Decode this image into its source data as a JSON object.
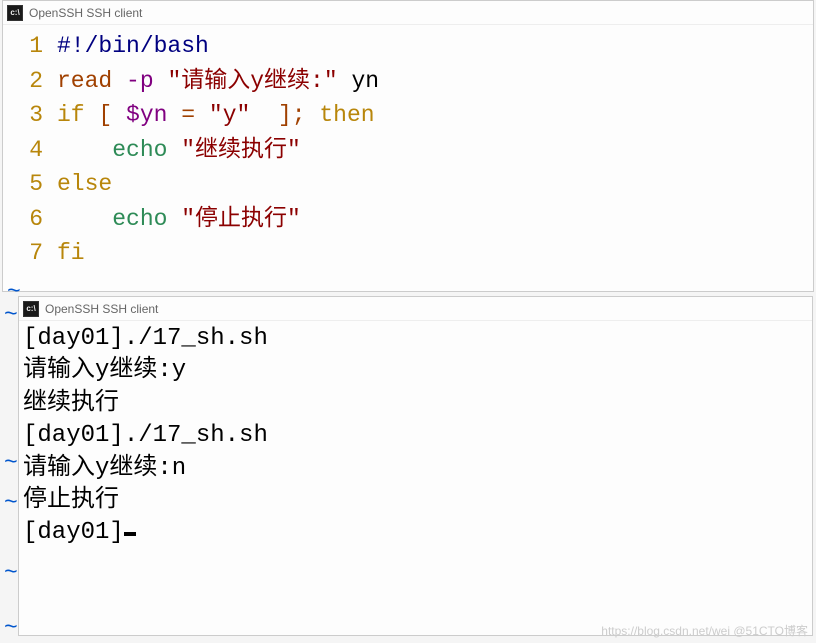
{
  "windows": {
    "editor": {
      "title": "OpenSSH SSH client",
      "icon_text": "c:\\"
    },
    "terminal": {
      "title": "OpenSSH SSH client",
      "icon_text": "c:\\"
    }
  },
  "code": {
    "lines": [
      {
        "num": "1",
        "tokens": [
          {
            "text": "#!/bin/bash",
            "cls": "tok-navy"
          }
        ]
      },
      {
        "num": "2",
        "tokens": [
          {
            "text": "read",
            "cls": "tok-brown"
          },
          {
            "text": " ",
            "cls": ""
          },
          {
            "text": "-p",
            "cls": "tok-purple"
          },
          {
            "text": " ",
            "cls": ""
          },
          {
            "text": "\"请输入y继续:\"",
            "cls": "tok-darkred"
          },
          {
            "text": " yn",
            "cls": ""
          }
        ]
      },
      {
        "num": "3",
        "tokens": [
          {
            "text": "if",
            "cls": "tok-yellow"
          },
          {
            "text": " ",
            "cls": ""
          },
          {
            "text": "[",
            "cls": "tok-brown"
          },
          {
            "text": " ",
            "cls": ""
          },
          {
            "text": "$yn",
            "cls": "tok-purple"
          },
          {
            "text": " ",
            "cls": ""
          },
          {
            "text": "=",
            "cls": "tok-brown"
          },
          {
            "text": " ",
            "cls": ""
          },
          {
            "text": "\"y\"",
            "cls": "tok-darkred"
          },
          {
            "text": "  ",
            "cls": ""
          },
          {
            "text": "]",
            "cls": "tok-brown"
          },
          {
            "text": ";",
            "cls": "tok-brown"
          },
          {
            "text": " ",
            "cls": ""
          },
          {
            "text": "then",
            "cls": "tok-yellow"
          }
        ]
      },
      {
        "num": "4",
        "tokens": [
          {
            "text": "    ",
            "cls": ""
          },
          {
            "text": "echo",
            "cls": "tok-green"
          },
          {
            "text": " ",
            "cls": ""
          },
          {
            "text": "\"继续执行\"",
            "cls": "tok-darkred"
          }
        ]
      },
      {
        "num": "5",
        "tokens": [
          {
            "text": "else",
            "cls": "tok-yellow"
          }
        ]
      },
      {
        "num": "6",
        "tokens": [
          {
            "text": "    ",
            "cls": ""
          },
          {
            "text": "echo",
            "cls": "tok-green"
          },
          {
            "text": " ",
            "cls": ""
          },
          {
            "text": "\"停止执行\"",
            "cls": "tok-darkred"
          }
        ]
      },
      {
        "num": "7",
        "tokens": [
          {
            "text": "fi",
            "cls": "tok-yellow"
          }
        ]
      }
    ],
    "tildes": [
      "~"
    ]
  },
  "terminal": {
    "lines": [
      "[day01]./17_sh.sh",
      "请输入y继续:y",
      "继续执行",
      "[day01]./17_sh.sh",
      "请输入y继续:n",
      "停止执行"
    ],
    "prompt": "[day01]"
  },
  "left_tildes": [
    "~",
    "~",
    "~",
    "~",
    "~"
  ],
  "watermark": "https://blog.csdn.net/wei @51CTO博客"
}
